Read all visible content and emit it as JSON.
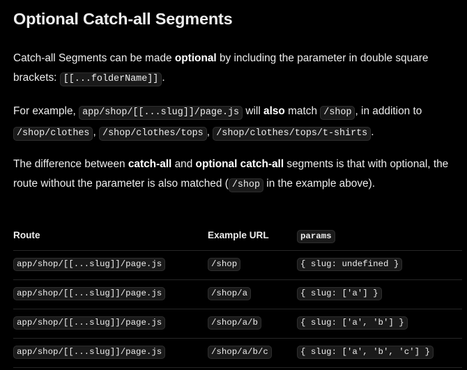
{
  "heading": "Optional Catch-all Segments",
  "p1": {
    "t1": "Catch-all Segments can be made ",
    "b1": "optional",
    "t2": " by including the parameter in double square brackets: ",
    "c1": "[[...folderName]]",
    "t3": "."
  },
  "p2": {
    "t1": "For example, ",
    "c1": "app/shop/[[...slug]]/page.js",
    "t2": " will ",
    "b1": "also",
    "t3": " match ",
    "c2": "/shop",
    "t4": ", in addition to ",
    "c3": "/shop/clothes",
    "t5": ", ",
    "c4": "/shop/clothes/tops",
    "t6": ", ",
    "c5": "/shop/clothes/tops/t-shirts",
    "t7": "."
  },
  "p3": {
    "t1": "The difference between ",
    "b1": "catch-all",
    "t2": " and ",
    "b2": "optional catch-all",
    "t3": " segments is that with optional, the route without the parameter is also matched (",
    "c1": "/shop",
    "t4": " in the example above)."
  },
  "table": {
    "headers": [
      "Route",
      "Example URL",
      "params"
    ],
    "rows": [
      [
        "app/shop/[[...slug]]/page.js",
        "/shop",
        "{ slug: undefined }"
      ],
      [
        "app/shop/[[...slug]]/page.js",
        "/shop/a",
        "{ slug: ['a'] }"
      ],
      [
        "app/shop/[[...slug]]/page.js",
        "/shop/a/b",
        "{ slug: ['a', 'b'] }"
      ],
      [
        "app/shop/[[...slug]]/page.js",
        "/shop/a/b/c",
        "{ slug: ['a', 'b', 'c'] }"
      ]
    ]
  }
}
